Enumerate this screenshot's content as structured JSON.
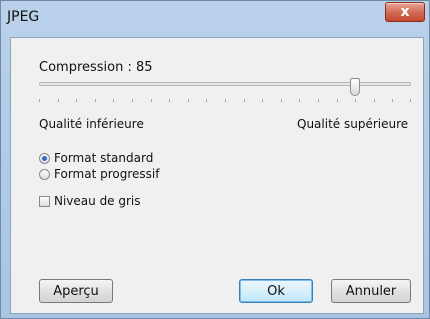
{
  "window": {
    "title": "JPEG",
    "close_glyph": "x"
  },
  "compression": {
    "label": "Compression : 85",
    "value": 85,
    "min": 0,
    "max": 100,
    "low_label": "Qualité inférieure",
    "high_label": "Qualité supérieure"
  },
  "format": {
    "options": [
      {
        "label": "Format standard",
        "checked": true
      },
      {
        "label": "Format progressif",
        "checked": false
      }
    ]
  },
  "grayscale": {
    "label": "Niveau de gris",
    "checked": false
  },
  "buttons": {
    "preview": "Aperçu",
    "ok": "Ok",
    "cancel": "Annuler"
  },
  "colors": {
    "accent": "#2c6fc6",
    "close_button": "#c4472f"
  }
}
